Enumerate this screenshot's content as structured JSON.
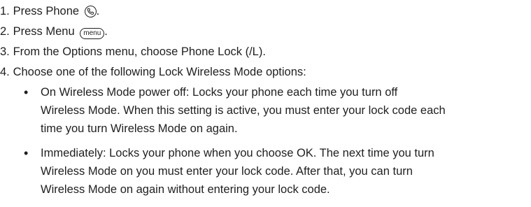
{
  "steps": [
    {
      "number": "1.",
      "before": "Press Phone",
      "icon": "phone-icon",
      "after": "."
    },
    {
      "number": "2.",
      "before": "Press Menu",
      "key_label": "menu",
      "after": "."
    },
    {
      "number": "3.",
      "text": "From the Options menu, choose Phone Lock (/L)."
    },
    {
      "number": "4.",
      "text": "Choose one of the following Lock Wireless Mode options:"
    }
  ],
  "options": [
    {
      "bullet": "•",
      "lines": [
        {
          "term": "On Wireless Mode power off:",
          "text": " Locks your phone each time you turn off"
        },
        {
          "text": "Wireless Mode. When this setting is active, you must enter your lock code each"
        },
        {
          "text": "time you turn Wireless Mode on again."
        }
      ]
    },
    {
      "bullet": "•",
      "lines": [
        {
          "term": "Immediately:",
          "text": " Locks your phone when you choose OK. The next time you turn"
        },
        {
          "text": "Wireless Mode on you must enter your lock code. After that, you can turn"
        },
        {
          "text": "Wireless Mode on again without entering your lock code."
        }
      ]
    }
  ]
}
